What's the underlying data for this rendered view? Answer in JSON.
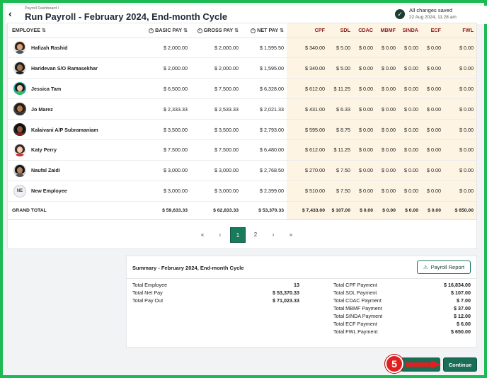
{
  "header": {
    "breadcrumb": "Payroll Dashboard /",
    "title": "Run Payroll - February 2024, End-month Cycle",
    "save_status": "All changes saved",
    "save_time": "22 Aug 2024, 11:28 am"
  },
  "table": {
    "columns": [
      "EMPLOYEE",
      "BASIC PAY",
      "GROSS PAY",
      "NET PAY",
      "CPF",
      "SDL",
      "CDAC",
      "MBMF",
      "SINDA",
      "ECF",
      "FWL"
    ],
    "rows": [
      {
        "name": "Hafizah Rashid",
        "basic": "$ 2,000.00",
        "gross": "$ 2,000.00",
        "net": "$ 1,595.50",
        "cpf": "$ 340.00",
        "sdl": "$ 5.00",
        "cdac": "$ 0.00",
        "mbmf": "$ 0.00",
        "sinda": "$ 0.00",
        "ecf": "$ 0.00",
        "fwl": "$ 0.00"
      },
      {
        "name": "Haridevan S/O Ramasekhar",
        "basic": "$ 2,000.00",
        "gross": "$ 2,000.00",
        "net": "$ 1,595.00",
        "cpf": "$ 340.00",
        "sdl": "$ 5.00",
        "cdac": "$ 0.00",
        "mbmf": "$ 0.00",
        "sinda": "$ 0.00",
        "ecf": "$ 0.00",
        "fwl": "$ 0.00"
      },
      {
        "name": "Jessica Tam",
        "basic": "$ 6,500.00",
        "gross": "$ 7,500.00",
        "net": "$ 6,328.00",
        "cpf": "$ 612.00",
        "sdl": "$ 11.25",
        "cdac": "$ 0.00",
        "mbmf": "$ 0.00",
        "sinda": "$ 0.00",
        "ecf": "$ 0.00",
        "fwl": "$ 0.00"
      },
      {
        "name": "Jo Marez",
        "basic": "$ 2,333.33",
        "gross": "$ 2,533.33",
        "net": "$ 2,021.33",
        "cpf": "$ 431.00",
        "sdl": "$ 6.33",
        "cdac": "$ 0.00",
        "mbmf": "$ 0.00",
        "sinda": "$ 0.00",
        "ecf": "$ 0.00",
        "fwl": "$ 0.00"
      },
      {
        "name": "Kalaivani A/P Subramaniam",
        "basic": "$ 3,500.00",
        "gross": "$ 3,500.00",
        "net": "$ 2,793.00",
        "cpf": "$ 595.00",
        "sdl": "$ 8.75",
        "cdac": "$ 0.00",
        "mbmf": "$ 0.00",
        "sinda": "$ 0.00",
        "ecf": "$ 0.00",
        "fwl": "$ 0.00"
      },
      {
        "name": "Katy Perry",
        "basic": "$ 7,500.00",
        "gross": "$ 7,500.00",
        "net": "$ 6,480.00",
        "cpf": "$ 612.00",
        "sdl": "$ 11.25",
        "cdac": "$ 0.00",
        "mbmf": "$ 0.00",
        "sinda": "$ 0.00",
        "ecf": "$ 0.00",
        "fwl": "$ 0.00"
      },
      {
        "name": "Naufal Zaidi",
        "basic": "$ 3,000.00",
        "gross": "$ 3,000.00",
        "net": "$ 2,768.50",
        "cpf": "$ 270.00",
        "sdl": "$ 7.50",
        "cdac": "$ 0.00",
        "mbmf": "$ 0.00",
        "sinda": "$ 0.00",
        "ecf": "$ 0.00",
        "fwl": "$ 0.00"
      },
      {
        "name": "New Employee",
        "initials": "NE",
        "basic": "$ 3,000.00",
        "gross": "$ 3,000.00",
        "net": "$ 2,399.00",
        "cpf": "$ 510.00",
        "sdl": "$ 7.50",
        "cdac": "$ 0.00",
        "mbmf": "$ 0.00",
        "sinda": "$ 0.00",
        "ecf": "$ 0.00",
        "fwl": "$ 0.00"
      }
    ],
    "total": {
      "label": "GRAND TOTAL",
      "basic": "$ 59,633.33",
      "gross": "$ 62,833.33",
      "net": "$ 53,370.33",
      "cpf": "$ 7,433.00",
      "sdl": "$ 107.00",
      "cdac": "$ 0.00",
      "mbmf": "$ 0.00",
      "sinda": "$ 0.00",
      "ecf": "$ 0.00",
      "fwl": "$ 650.00"
    }
  },
  "pagination": {
    "first": "«",
    "prev": "‹",
    "pages": [
      "1",
      "2"
    ],
    "active": "1",
    "next": "›",
    "last": "»"
  },
  "summary": {
    "title": "Summary - February 2024, End-month Cycle",
    "report_button": "Payroll Report",
    "left": [
      {
        "label": "Total Employee",
        "value": "13"
      },
      {
        "label": "Total Net Pay",
        "value": "$ 53,370.33"
      },
      {
        "label": "Total Pay Out",
        "value": "$ 71,023.33"
      }
    ],
    "right": [
      {
        "label": "Total CPF Payment",
        "value": "$ 16,834.00"
      },
      {
        "label": "Total SDL Payment",
        "value": "$ 107.00"
      },
      {
        "label": "Total CDAC Payment",
        "value": "$ 7.00"
      },
      {
        "label": "Total MBMF Payment",
        "value": "$ 37.00"
      },
      {
        "label": "Total SINDA Payment",
        "value": "$ 12.00"
      },
      {
        "label": "Total ECF Payment",
        "value": "$ 6.00"
      },
      {
        "label": "Total FWL Payment",
        "value": "$ 650.00"
      }
    ]
  },
  "actions": {
    "back_label": "k",
    "continue_label": "Continue",
    "step_number": "5"
  },
  "colors": {
    "accent": "#1a7a5c",
    "tint": "#fdf4e3",
    "frame": "#1db954",
    "annotation": "#e02020"
  }
}
